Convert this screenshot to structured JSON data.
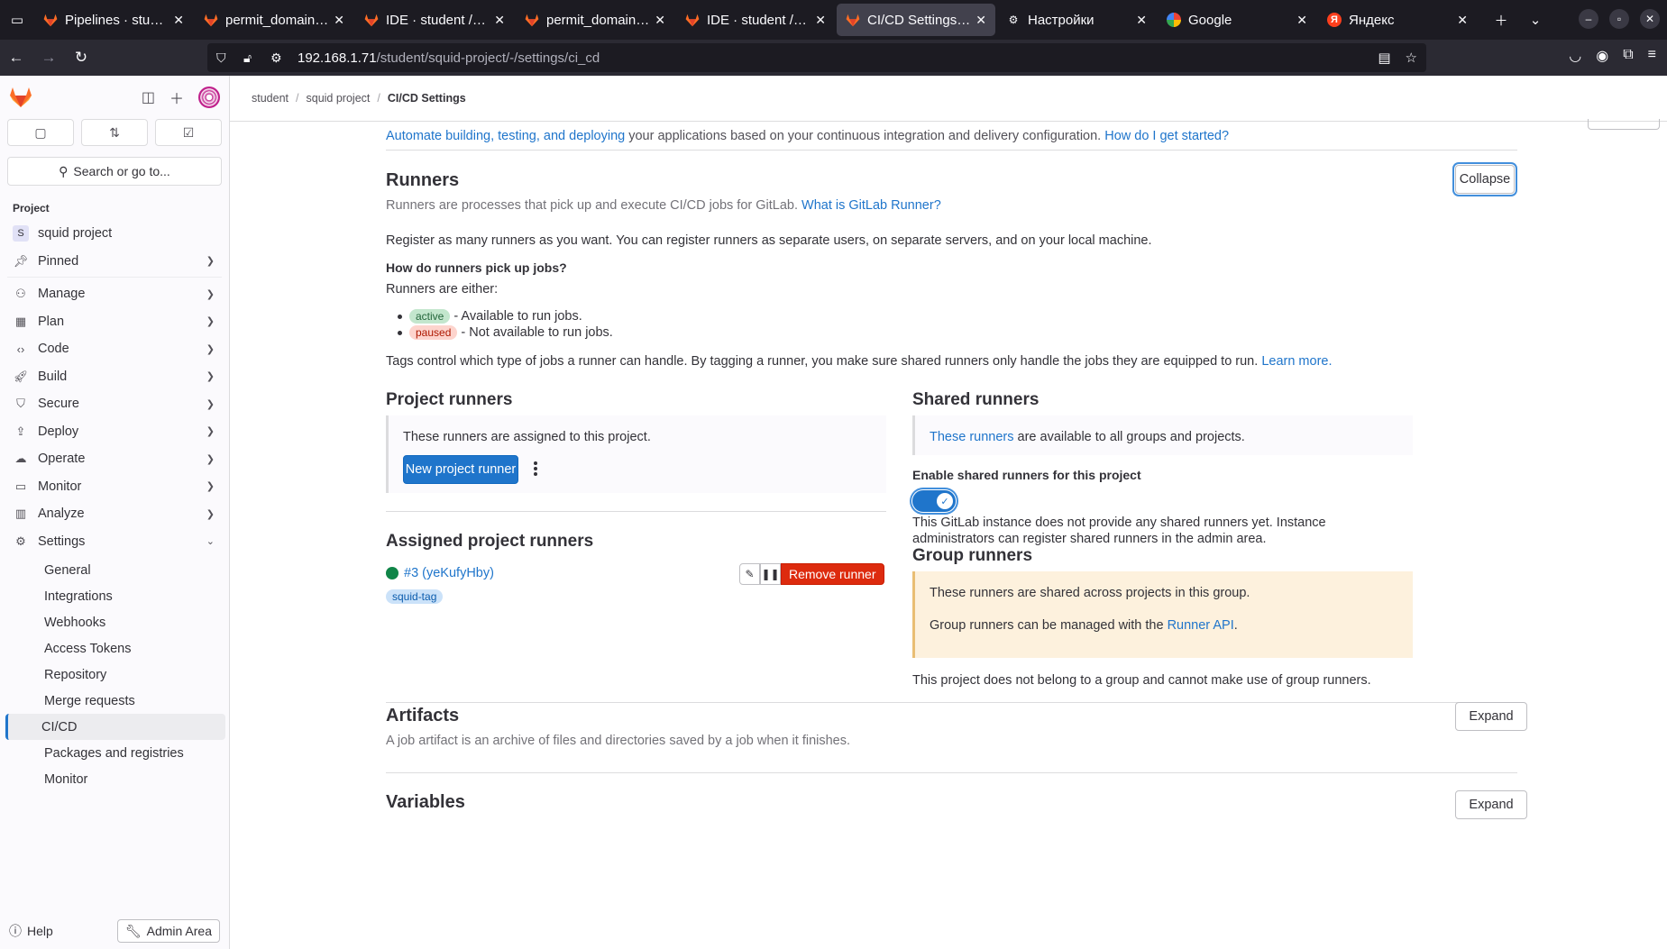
{
  "browser": {
    "tabs": [
      {
        "title": "Pipelines · student",
        "favicon": "gitlab-fox",
        "active": false
      },
      {
        "title": "permit_domains.txt",
        "favicon": "gitlab-fox",
        "active": false
      },
      {
        "title": "IDE · student / squid",
        "favicon": "gitlab-fox",
        "active": false
      },
      {
        "title": "permit_domains.txt",
        "favicon": "gitlab-fox",
        "active": false
      },
      {
        "title": "IDE · student / squid",
        "favicon": "gitlab-fox",
        "active": false
      },
      {
        "title": "CI/CD Settings · CI/CD",
        "favicon": "gitlab-fox",
        "active": true
      },
      {
        "title": "Настройки",
        "favicon": "gear-icon",
        "active": false
      },
      {
        "title": "Google",
        "favicon": "google",
        "active": false
      },
      {
        "title": "Яндекс",
        "favicon": "yandex",
        "active": false
      }
    ],
    "yandex_letter": "Я",
    "url_host": "192.168.1.71",
    "url_path": "/student/squid-project/-/settings/ci_cd"
  },
  "sidebar": {
    "search_placeholder": "Search or go to...",
    "section_label": "Project",
    "project_initial": "S",
    "project_name": "squid project",
    "pinned": "Pinned",
    "nav": [
      {
        "label": "Manage",
        "icon": "users-icon"
      },
      {
        "label": "Plan",
        "icon": "calendar-icon"
      },
      {
        "label": "Code",
        "icon": "code-icon"
      },
      {
        "label": "Build",
        "icon": "rocket-icon"
      },
      {
        "label": "Secure",
        "icon": "shield-icon"
      },
      {
        "label": "Deploy",
        "icon": "deploy-icon"
      },
      {
        "label": "Operate",
        "icon": "cloud-gear-icon"
      },
      {
        "label": "Monitor",
        "icon": "monitor-icon"
      },
      {
        "label": "Analyze",
        "icon": "chart-icon"
      }
    ],
    "settings": "Settings",
    "settings_items": [
      "General",
      "Integrations",
      "Webhooks",
      "Access Tokens",
      "Repository",
      "Merge requests",
      "CI/CD",
      "Packages and registries",
      "Monitor"
    ],
    "active_item": "CI/CD",
    "help": "Help",
    "admin": "Admin Area"
  },
  "breadcrumb": [
    "student",
    "squid project",
    "CI/CD Settings"
  ],
  "intro": {
    "link": "Automate building, testing, and deploying",
    "text": " your applications based on your continuous integration and delivery configuration. ",
    "link2": "How do I get started?"
  },
  "runners": {
    "title": "Runners",
    "desc": "Runners are processes that pick up and execute CI/CD jobs for GitLab. ",
    "desc_link": "What is GitLab Runner?",
    "collapse": "Collapse",
    "register_text": "Register as many runners as you want. You can register runners as separate users, on separate servers, and on your local machine.",
    "how_title": "How do runners pick up jobs?",
    "either": "Runners are either:",
    "active_badge": "active",
    "active_text": " - Available to run jobs.",
    "paused_badge": "paused",
    "paused_text": " - Not available to run jobs.",
    "tags_text": "Tags control which type of jobs a runner can handle. By tagging a runner, you make sure shared runners only handle the jobs they are equipped to run. ",
    "learn_more": "Learn more."
  },
  "project_runners": {
    "title": "Project runners",
    "panel_text": "These runners are assigned to this project.",
    "new_button": "New project runner",
    "assigned_title": "Assigned project runners",
    "runner_name": "#3 (yeKufyHby)",
    "runner_tag": "squid-tag",
    "remove": "Remove runner"
  },
  "shared_runners": {
    "title": "Shared runners",
    "link": "These runners",
    "panel_text": " are available to all groups and projects.",
    "enable_label": "Enable shared runners for this project",
    "enabled": true,
    "note": "This GitLab instance does not provide any shared runners yet. Instance administrators can register shared runners in the admin area."
  },
  "group_runners": {
    "title": "Group runners",
    "line1": "These runners are shared across projects in this group.",
    "line2": "Group runners can be managed with the ",
    "api_link": "Runner API",
    "line2_end": ".",
    "note": "This project does not belong to a group and cannot make use of group runners."
  },
  "artifacts": {
    "title": "Artifacts",
    "desc": "A job artifact is an archive of files and directories saved by a job when it finishes.",
    "expand": "Expand"
  },
  "variables": {
    "title": "Variables",
    "expand": "Expand"
  },
  "colors": {
    "primary": "#1f75cb",
    "danger": "#dd2b0e",
    "success": "#108548"
  }
}
